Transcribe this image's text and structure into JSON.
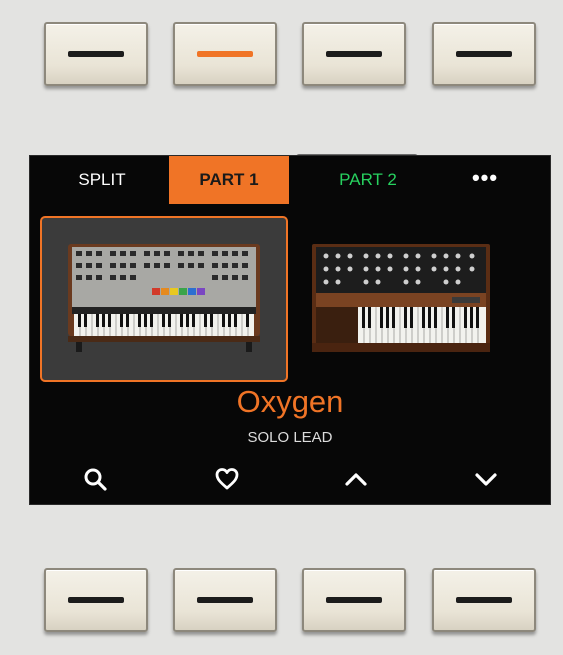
{
  "top_buttons": [
    {
      "name": "top-button-1",
      "active": false
    },
    {
      "name": "top-button-2",
      "active": true,
      "indicator_color": "#f07426"
    },
    {
      "name": "top-button-3",
      "active": false
    },
    {
      "name": "top-button-4",
      "active": false
    }
  ],
  "screen": {
    "tabs": {
      "split": "SPLIT",
      "part1": "PART 1",
      "part2": "PART 2",
      "more": "•••"
    },
    "instruments": [
      {
        "name": "polysynth",
        "selected": true
      },
      {
        "name": "monosynth",
        "selected": false
      }
    ],
    "preset": {
      "name": "Oxygen",
      "category": "SOLO LEAD"
    },
    "actions": [
      "search-icon",
      "heart-icon",
      "chevron-up-icon",
      "chevron-down-icon"
    ]
  },
  "bottom_buttons": [
    {
      "name": "bottom-button-1"
    },
    {
      "name": "bottom-button-2"
    },
    {
      "name": "bottom-button-3"
    },
    {
      "name": "bottom-button-4"
    }
  ],
  "colors": {
    "accent": "#f07426",
    "part2": "#27d15f",
    "screen_bg": "#070707",
    "panel": "#e3e3e1"
  }
}
